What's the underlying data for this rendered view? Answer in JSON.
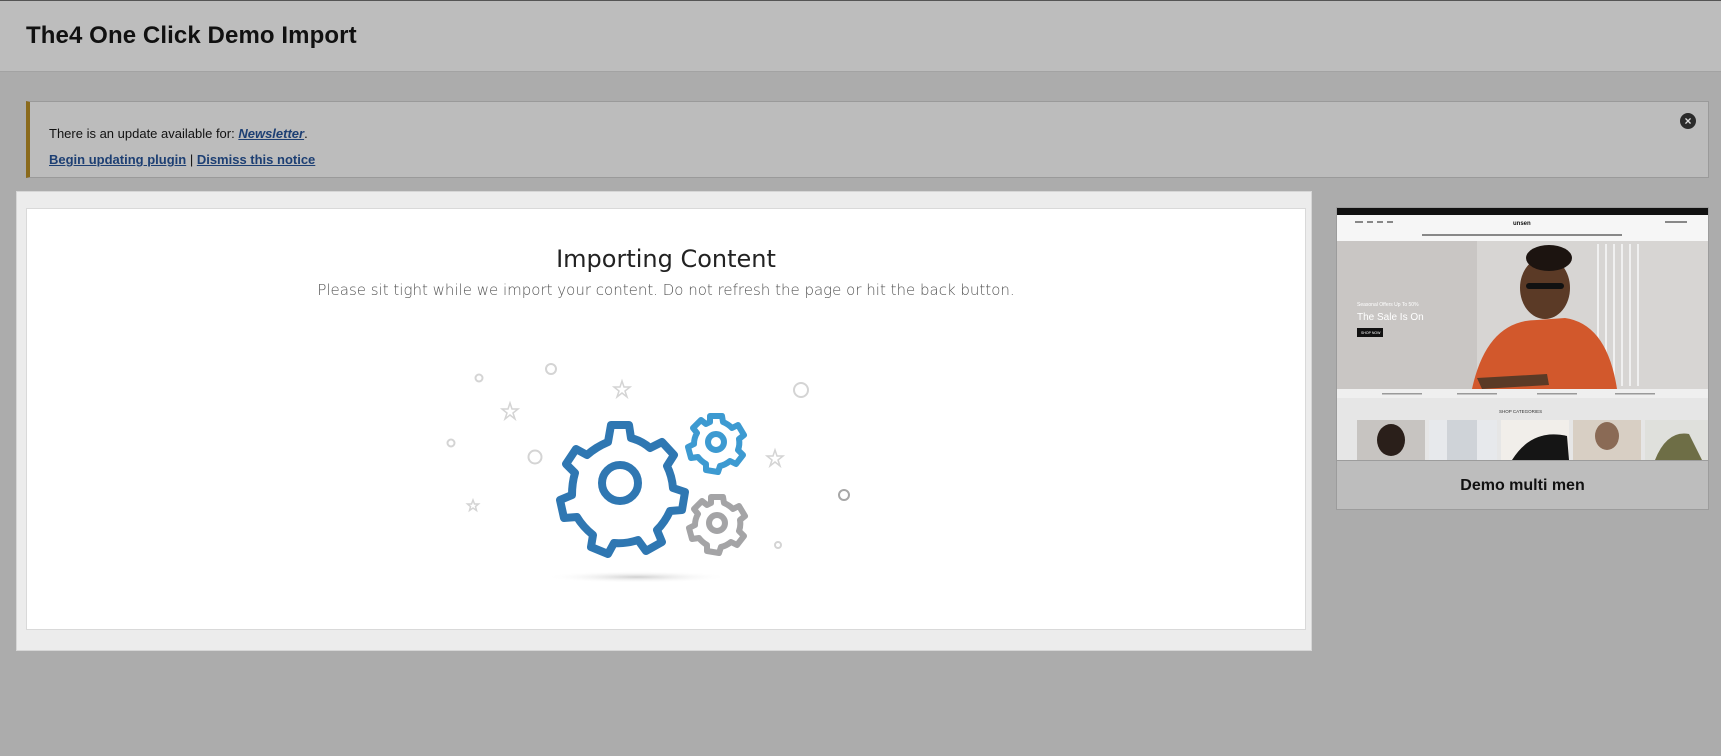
{
  "header": {
    "title": "The4 One Click Demo Import"
  },
  "notice": {
    "text_prefix": "There is an update available for: ",
    "plugin_name": "Newsletter",
    "text_suffix": ".",
    "begin_update_label": "Begin updating plugin",
    "separator": " | ",
    "dismiss_label": "Dismiss this notice",
    "close_icon": "close-circle-icon",
    "accent_color": "#8a6a1c"
  },
  "import": {
    "title": "Importing Content",
    "subtitle": "Please sit tight while we import your content. Do not refresh the page or hit the back button.",
    "gear_colors": {
      "large": "#2f77b2",
      "small_top": "#3d9ad1",
      "small_bottom": "#a4a4a6"
    }
  },
  "demo": {
    "name": "Demo multi men",
    "thumb": {
      "logo": "unsen",
      "hero_line1": "Seasonal Offers Up To 50%",
      "hero_line2": "The Sale Is On",
      "hero_button": "SHOP NOW",
      "categories_title": "SHOP CATEGORIES"
    }
  }
}
